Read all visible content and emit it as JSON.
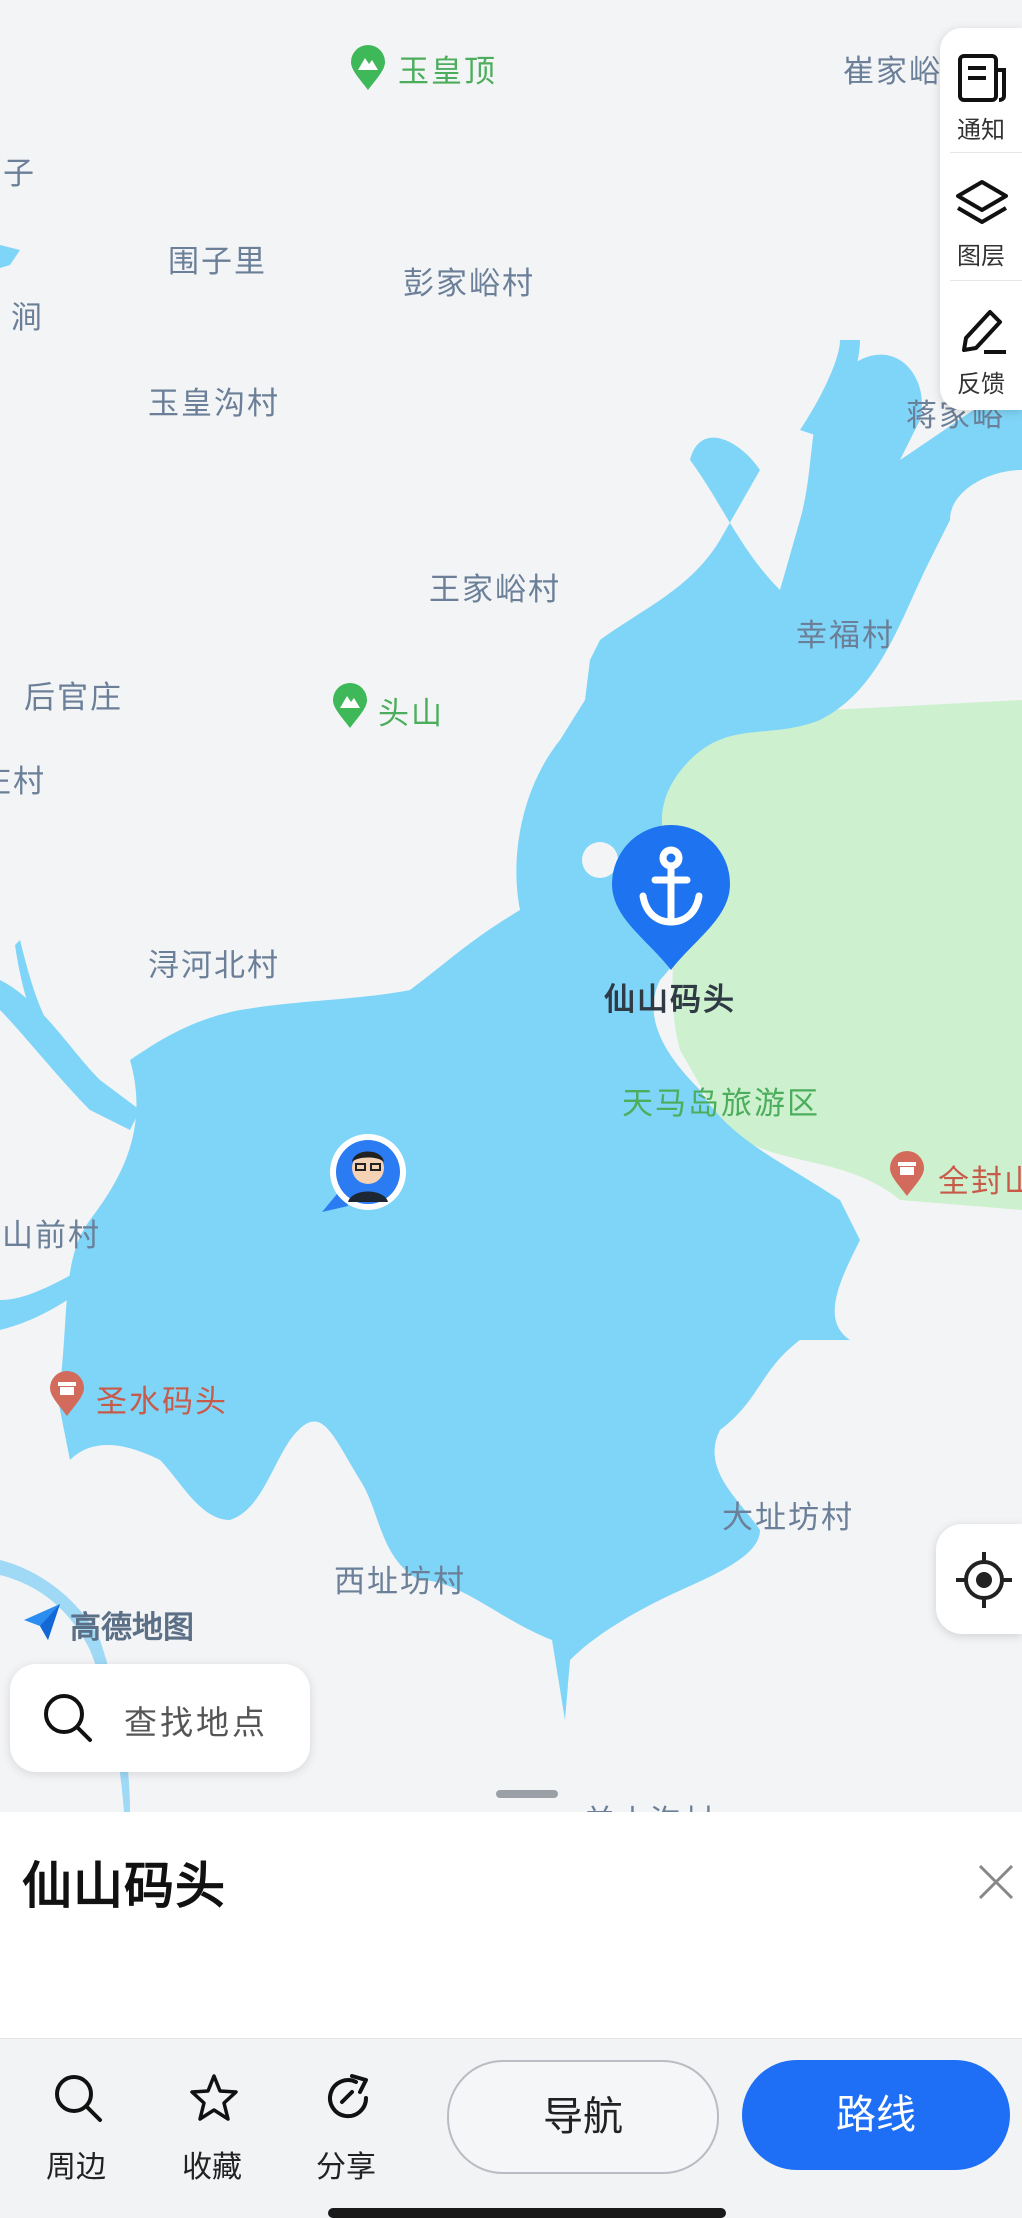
{
  "map": {
    "places": [
      {
        "key": "yuhuangding",
        "label": "玉皇顶"
      },
      {
        "key": "cuijia",
        "label": "崔家峪"
      },
      {
        "key": "zi",
        "label": "子"
      },
      {
        "key": "weizili",
        "label": "围子里"
      },
      {
        "key": "pengjiayu",
        "label": "彭家峪村"
      },
      {
        "key": "jian",
        "label": "涧"
      },
      {
        "key": "yuhuanggou",
        "label": "玉皇沟村"
      },
      {
        "key": "jiangjia",
        "label": "蒋家峪"
      },
      {
        "key": "wangjiayu",
        "label": "王家峪村"
      },
      {
        "key": "xingfu",
        "label": "幸福村"
      },
      {
        "key": "houguanzhuang",
        "label": "后官庄"
      },
      {
        "key": "toushan",
        "label": "头山"
      },
      {
        "key": "zhuangcun",
        "label": "庄村"
      },
      {
        "key": "xunhebei",
        "label": "浔河北村"
      },
      {
        "key": "tianmadao",
        "label": "天马岛旅游区"
      },
      {
        "key": "quanfeng",
        "label": "全封山"
      },
      {
        "key": "shanqian",
        "label": "山前村"
      },
      {
        "key": "shengshui",
        "label": "圣水码头"
      },
      {
        "key": "dazhifang",
        "label": "大址坊村"
      },
      {
        "key": "xizhifang",
        "label": "西址坊村"
      },
      {
        "key": "bottom_cut",
        "label": "羊山沟村"
      }
    ],
    "pin_label": "仙山码头",
    "logo_text": "高德地图",
    "colors": {
      "water": "#7fd5f7",
      "land": "#f3f4f6",
      "park": "#cdf1ce",
      "pin": "#1e73f0",
      "route_button": "#1e6ff5"
    }
  },
  "side_panel": {
    "items": [
      {
        "label": "通知",
        "icon": "notice-icon"
      },
      {
        "label": "图层",
        "icon": "layers-icon"
      },
      {
        "label": "反馈",
        "icon": "feedback-icon"
      }
    ]
  },
  "search": {
    "placeholder": "查找地点"
  },
  "sheet": {
    "title": "仙山码头"
  },
  "actions": {
    "nearby": "周边",
    "favorite": "收藏",
    "share": "分享",
    "navigate": "导航",
    "route": "路线"
  }
}
